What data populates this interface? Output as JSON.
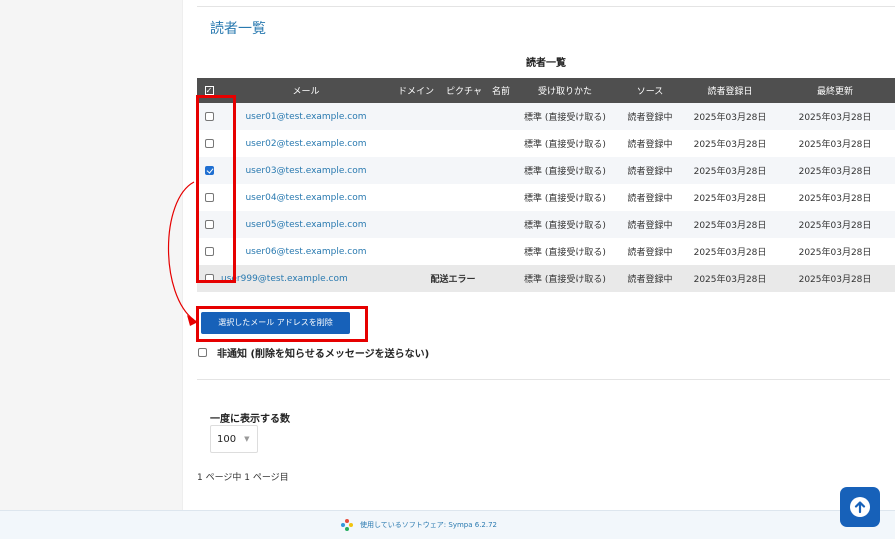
{
  "page_title": "読者一覧",
  "table": {
    "caption": "読者一覧",
    "columns": [
      "メール",
      "ドメイン",
      "ピクチャ",
      "名前",
      "受け取りかた",
      "ソース",
      "読者登録日",
      "最終更新"
    ],
    "rows": [
      {
        "email": "user01@test.example.com",
        "status": "",
        "delivery": "標準 (直接受け取る)",
        "source": "読者登録中",
        "date": "2025年03月28日",
        "updated": "2025年03月28日",
        "checked": false
      },
      {
        "email": "user02@test.example.com",
        "status": "",
        "delivery": "標準 (直接受け取る)",
        "source": "読者登録中",
        "date": "2025年03月28日",
        "updated": "2025年03月28日",
        "checked": false
      },
      {
        "email": "user03@test.example.com",
        "status": "",
        "delivery": "標準 (直接受け取る)",
        "source": "読者登録中",
        "date": "2025年03月28日",
        "updated": "2025年03月28日",
        "checked": true
      },
      {
        "email": "user04@test.example.com",
        "status": "",
        "delivery": "標準 (直接受け取る)",
        "source": "読者登録中",
        "date": "2025年03月28日",
        "updated": "2025年03月28日",
        "checked": false
      },
      {
        "email": "user05@test.example.com",
        "status": "",
        "delivery": "標準 (直接受け取る)",
        "source": "読者登録中",
        "date": "2025年03月28日",
        "updated": "2025年03月28日",
        "checked": false
      },
      {
        "email": "user06@test.example.com",
        "status": "",
        "delivery": "標準 (直接受け取る)",
        "source": "読者登録中",
        "date": "2025年03月28日",
        "updated": "2025年03月28日",
        "checked": false
      },
      {
        "email": "user999@test.example.com",
        "status": "配送エラー",
        "delivery": "標準 (直接受け取る)",
        "source": "読者登録中",
        "date": "2025年03月28日",
        "updated": "2025年03月28日",
        "checked": false
      }
    ]
  },
  "actions": {
    "delete_label": "選択したメール アドレスを削除",
    "quiet_label": "非通知 (削除を知らせるメッセージを送らない)",
    "quiet_checked": false
  },
  "pagination": {
    "per_page_label": "一度に表示する数",
    "per_page_value": "100",
    "page_info": "1 ページ中 1 ページ目"
  },
  "footer": {
    "text": "使用しているソフトウェア: Sympa 6.2.72"
  },
  "icons": {
    "scroll_top": "arrow-up-icon",
    "footer_logo": "sympa-logo-icon"
  },
  "colors": {
    "link": "#2a7ab0",
    "primary_button": "#1761b9",
    "annotation": "#e60000",
    "table_header": "#4f4f4f"
  }
}
